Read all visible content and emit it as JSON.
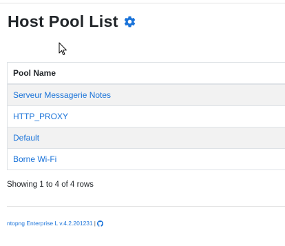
{
  "header": {
    "title": "Host Pool List",
    "settings_icon": "gear-icon",
    "accent_color": "#1a73d9"
  },
  "table": {
    "columns": [
      "Pool Name"
    ],
    "rows": [
      {
        "pool_name": "Serveur Messagerie Notes"
      },
      {
        "pool_name": "HTTP_PROXY"
      },
      {
        "pool_name": "Default"
      },
      {
        "pool_name": "Borne Wi-Fi"
      }
    ]
  },
  "pagination": {
    "summary": "Showing 1 to 4 of 4 rows"
  },
  "footer": {
    "version_text": "ntopng Enterprise L v.4.2.201231",
    "separator": "|",
    "repo_icon": "github-icon"
  }
}
